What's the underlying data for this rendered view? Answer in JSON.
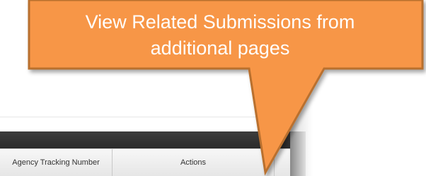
{
  "callout": {
    "line1": "View Related Submissions from",
    "line2": "additional pages",
    "fill_color": "#F79646",
    "border_color": "#B96F2E"
  },
  "table": {
    "columns": [
      {
        "label": "Agency Tracking Number"
      },
      {
        "label": "Actions"
      }
    ]
  }
}
